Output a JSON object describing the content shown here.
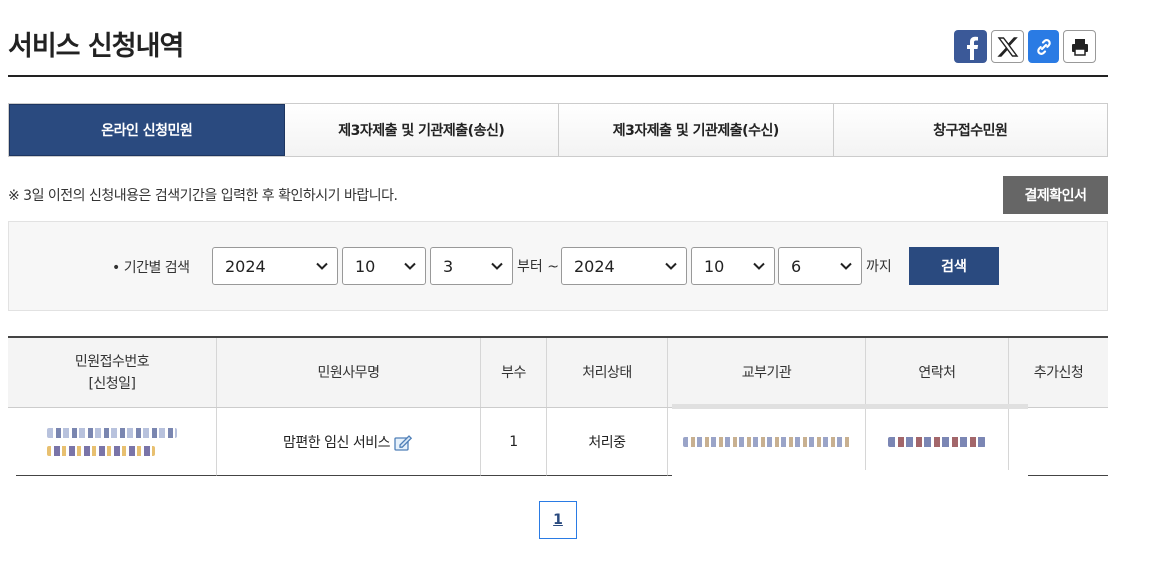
{
  "page": {
    "title": "서비스 신청내역"
  },
  "share": {
    "facebook": "facebook-icon",
    "x": "x-icon",
    "link": "link-icon",
    "print": "print-icon"
  },
  "tabs": [
    {
      "label": "온라인 신청민원",
      "active": true
    },
    {
      "label": "제3자제출 및 기관제출(송신)",
      "active": false
    },
    {
      "label": "제3자제출 및 기관제출(수신)",
      "active": false
    },
    {
      "label": "창구접수민원",
      "active": false
    }
  ],
  "notice": "※ 3일 이전의 신청내용은 검색기간을 입력한 후 확인하시기 바랍니다.",
  "payment_button": "결제확인서",
  "search": {
    "label": "• 기간별 검색",
    "from_year": "2024",
    "from_month": "10",
    "from_day": "3",
    "from_suffix": "부터 ~",
    "to_year": "2024",
    "to_month": "10",
    "to_day": "6",
    "to_suffix": "까지",
    "button": "검색"
  },
  "table": {
    "headers": {
      "receipt_no": "민원접수번호",
      "receipt_date": "[신청일]",
      "service_name": "민원사무명",
      "copies": "부수",
      "status": "처리상태",
      "agency": "교부기관",
      "contact": "연락처",
      "extra": "추가신청"
    },
    "rows": [
      {
        "service_name": "맘편한 임신 서비스",
        "copies": "1",
        "status": "처리중"
      }
    ]
  },
  "pagination": {
    "current": "1"
  },
  "colors": {
    "primary": "#2a4a7f",
    "facebook": "#3b5998",
    "link": "#2a7be4",
    "gray_button": "#666666"
  }
}
